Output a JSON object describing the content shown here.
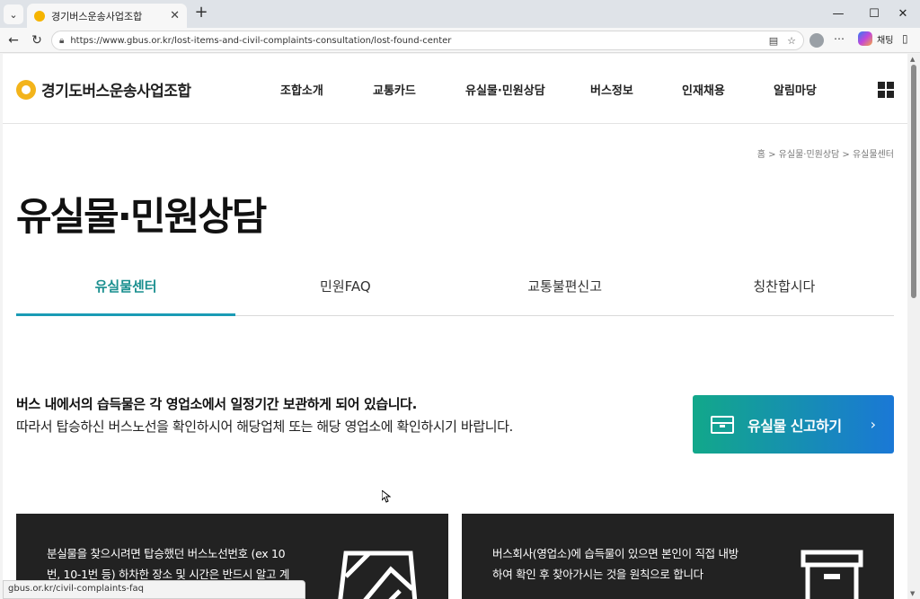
{
  "browser": {
    "tab_title": "경기버스운송사업조합",
    "url": "https://www.gbus.or.kr/lost-items-and-civil-complaints-consultation/lost-found-center",
    "copilot_label": "채팅",
    "status_url": "gbus.or.kr/civil-complaints-faq"
  },
  "site": {
    "logo_text": "경기도버스운송사업조합",
    "nav": [
      "조합소개",
      "교통카드",
      "유실물·민원상담",
      "버스정보",
      "인재채용",
      "알림마당"
    ]
  },
  "breadcrumb": "홈 > 유실물·민원상담 > 유실물센터",
  "page_title": "유실물·민원상담",
  "tabs": [
    {
      "label": "유실물센터",
      "active": true
    },
    {
      "label": "민원FAQ",
      "active": false
    },
    {
      "label": "교통불편신고",
      "active": false
    },
    {
      "label": "칭찬합시다",
      "active": false
    }
  ],
  "intro": {
    "strong": "버스 내에서의 습득물은 각 영업소에서 일정기간 보관하게 되어 있습니다.",
    "text": "따라서 탑승하신 버스노선을 확인하시어 해당업체 또는 해당 영업소에 확인하시기 바랍니다."
  },
  "report_button": {
    "label": "유실물 신고하기",
    "colors": [
      "#12a88a",
      "#1a78d6"
    ]
  },
  "cards": [
    {
      "text": "분실물을 찾으시려면 탑승했던 버스노선번호 (ex 10번, 10-1번 등) 하차한 장소 및 시간은 반드시 알고 계셔야 합니다",
      "icon": "map-icon"
    },
    {
      "text": "버스회사(영업소)에 습득물이 있으면 본인이 직접 내방하여 확인 후 찾아가시는 것을 원칙으로 합니다",
      "icon": "archive-box-icon"
    }
  ]
}
